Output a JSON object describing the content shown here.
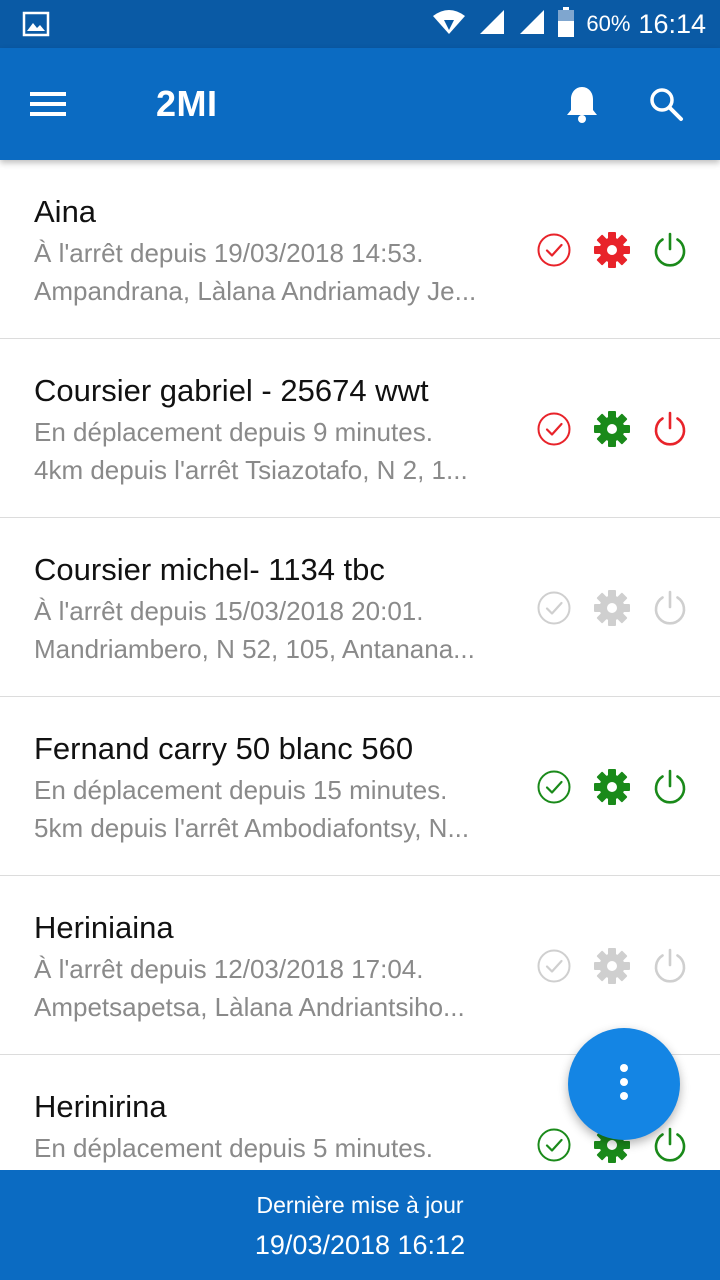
{
  "status_bar": {
    "battery": "60%",
    "time": "16:14"
  },
  "app_bar": {
    "title": "2MI",
    "icons": [
      "menu-icon",
      "bell-icon",
      "search-icon"
    ]
  },
  "colors": {
    "primary": "#0b6bc2",
    "status_bar": "#0a5aa5",
    "fab": "#1485e4",
    "red": "#e8232a",
    "green": "#1a8a1a",
    "gray": "#cfcfcf"
  },
  "vehicles": [
    {
      "name": "Aina",
      "status": "À l'arrêt depuis 19/03/2018 14:53.",
      "location": "Ampandrana, Làlana Andriamady Je...",
      "check": "red",
      "gear": "red",
      "power": "green"
    },
    {
      "name": "Coursier gabriel - 25674 wwt",
      "status": "En déplacement depuis 9 minutes.",
      "location": "4km depuis l'arrêt Tsiazotafo, N 2, 1...",
      "check": "red",
      "gear": "green",
      "power": "red"
    },
    {
      "name": "Coursier michel- 1134 tbc",
      "status": "À l'arrêt depuis 15/03/2018 20:01.",
      "location": "Mandriambero, N 52, 105, Antanana...",
      "check": "gray",
      "gear": "gray",
      "power": "gray"
    },
    {
      "name": "Fernand carry 50 blanc 560",
      "status": "En déplacement depuis 15 minutes.",
      "location": "5km depuis l'arrêt Ambodiafontsy, N...",
      "check": "green",
      "gear": "green",
      "power": "green"
    },
    {
      "name": "Heriniaina",
      "status": "À l'arrêt depuis 12/03/2018 17:04.",
      "location": "Ampetsapetsa, Làlana Andriantsiho...",
      "check": "gray",
      "gear": "gray",
      "power": "gray"
    },
    {
      "name": "Herinirina",
      "status": "En déplacement depuis 5 minutes.",
      "location": "",
      "check": "green",
      "gear": "green",
      "power": "green"
    }
  ],
  "footer": {
    "label": "Dernière mise à jour",
    "value": "19/03/2018 16:12"
  },
  "fab_icon": "more-vertical-icon"
}
